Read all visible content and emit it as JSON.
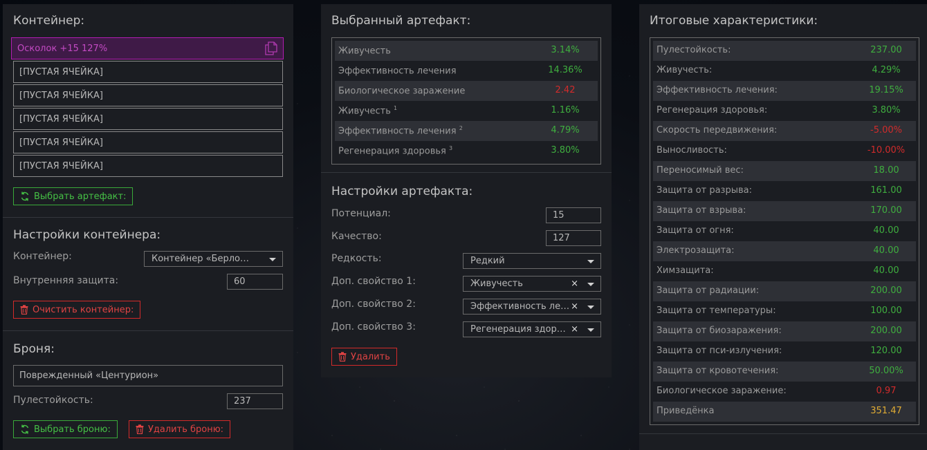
{
  "colors": {
    "positive": "#3fae3f",
    "negative": "#d22b2b",
    "highlight": "#e0ac34",
    "accent_purple": "#b31cb3"
  },
  "container": {
    "title": "Контейнер:",
    "active_slot": {
      "label": "Осколок +15 127%",
      "icon": "copy-icon"
    },
    "empty_slots": [
      "[ПУСТАЯ ЯЧЕЙКА]",
      "[ПУСТАЯ ЯЧЕЙКА]",
      "[ПУСТАЯ ЯЧЕЙКА]",
      "[ПУСТАЯ ЯЧЕЙКА]",
      "[ПУСТАЯ ЯЧЕЙКА]"
    ],
    "choose_button": "Выбрать артефакт:"
  },
  "container_settings": {
    "title": "Настройки контейнера:",
    "container_label": "Контейнер:",
    "container_value": "Контейнер «Берлога»",
    "inner_protection_label": "Внутренняя защита:",
    "inner_protection_value": "60",
    "clear_button": "Очистить контейнер:"
  },
  "armor": {
    "title": "Броня:",
    "name": "Поврежденный «Центурион»",
    "bulletproof_label": "Пулестойкость:",
    "bulletproof_value": "237",
    "choose_button": "Выбрать броню:",
    "delete_button": "Удалить броню:"
  },
  "selected_artifact": {
    "title": "Выбранный артефакт:",
    "rows": [
      {
        "name": "Живучесть",
        "sup": "",
        "value": "3.14%",
        "tone": "pos"
      },
      {
        "name": "Эффективность лечения",
        "sup": "",
        "value": "14.36%",
        "tone": "pos"
      },
      {
        "name": "Биологическое заражение",
        "sup": "",
        "value": "2.42",
        "tone": "neg"
      },
      {
        "name": "Живучесть",
        "sup": "1",
        "value": "1.16%",
        "tone": "pos"
      },
      {
        "name": "Эффективность лечения",
        "sup": "2",
        "value": "4.79%",
        "tone": "pos"
      },
      {
        "name": "Регенерация здоровья",
        "sup": "3",
        "value": "3.80%",
        "tone": "pos"
      }
    ]
  },
  "artifact_settings": {
    "title": "Настройки артефакта:",
    "potential_label": "Потенциал:",
    "potential_value": "15",
    "quality_label": "Качество:",
    "quality_value": "127",
    "rarity_label": "Редкость:",
    "rarity_value": "Редкий",
    "prop1_label": "Доп. свойство 1:",
    "prop1_value": "Живучесть",
    "prop2_label": "Доп. свойство 2:",
    "prop2_value": "Эффективность лечения",
    "prop3_label": "Доп. свойство 3:",
    "prop3_value": "Регенерация здоровья",
    "clear_symbol": "×",
    "delete_button": "Удалить"
  },
  "final_stats": {
    "title": "Итоговые характеристики:",
    "rows": [
      {
        "name": "Пулестойкость:",
        "value": "237.00",
        "tone": "pos"
      },
      {
        "name": "Живучесть:",
        "value": "4.29%",
        "tone": "pos"
      },
      {
        "name": "Эффективность лечения:",
        "value": "19.15%",
        "tone": "pos"
      },
      {
        "name": "Регенерация здоровья:",
        "value": "3.80%",
        "tone": "pos"
      },
      {
        "name": "Скорость передвижения:",
        "value": "-5.00%",
        "tone": "neg"
      },
      {
        "name": "Выносливость:",
        "value": "-10.00%",
        "tone": "neg"
      },
      {
        "name": "Переносимый вес:",
        "value": "18.00",
        "tone": "pos"
      },
      {
        "name": "Защита от разрыва:",
        "value": "161.00",
        "tone": "pos"
      },
      {
        "name": "Защита от взрыва:",
        "value": "170.00",
        "tone": "pos"
      },
      {
        "name": "Защита от огня:",
        "value": "40.00",
        "tone": "pos"
      },
      {
        "name": "Электрозащита:",
        "value": "40.00",
        "tone": "pos"
      },
      {
        "name": "Химзащита:",
        "value": "40.00",
        "tone": "pos"
      },
      {
        "name": "Защита от радиации:",
        "value": "200.00",
        "tone": "pos"
      },
      {
        "name": "Защита от температуры:",
        "value": "100.00",
        "tone": "pos"
      },
      {
        "name": "Защита от биозаражения:",
        "value": "200.00",
        "tone": "pos"
      },
      {
        "name": "Защита от пси-излучения:",
        "value": "120.00",
        "tone": "pos"
      },
      {
        "name": "Защита от кровотечения:",
        "value": "50.00%",
        "tone": "pos"
      },
      {
        "name": "Биологическое заражение:",
        "value": "0.97",
        "tone": "neg"
      },
      {
        "name": "Приведёнка",
        "value": "351.47",
        "tone": "gold"
      }
    ]
  }
}
